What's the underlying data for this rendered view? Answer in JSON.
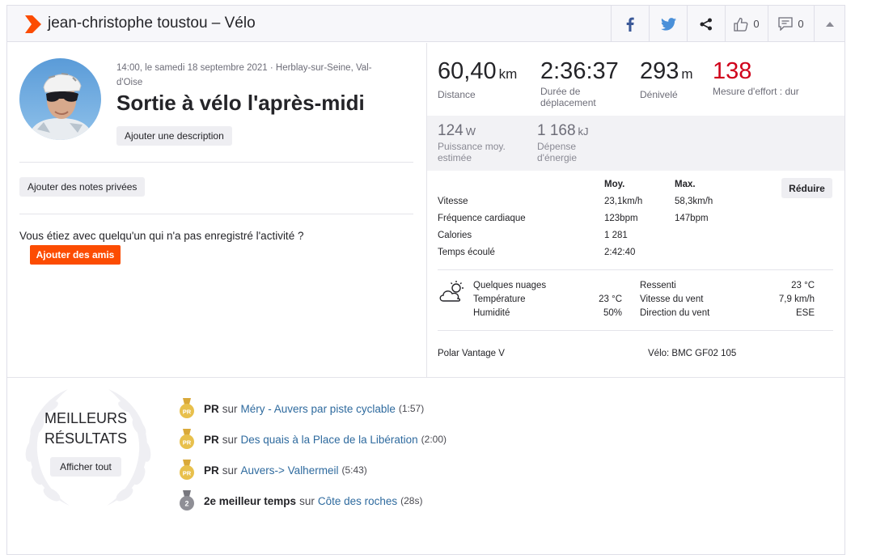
{
  "header": {
    "title": "jean-christophe toustou – Vélo",
    "kudos_count": "0",
    "comments_count": "0"
  },
  "activity": {
    "meta": "14:00, le samedi 18 septembre 2021 · Herblay-sur-Seine, Val-d'Oise",
    "title": "Sortie à vélo l'après-midi",
    "add_description": "Ajouter une description",
    "add_private_notes": "Ajouter des notes privées",
    "with_question": "Vous étiez avec quelqu'un qui n'a pas enregistré l'activité ?",
    "add_friends": "Ajouter des amis"
  },
  "stats": {
    "distance": {
      "value": "60,40",
      "unit": "km",
      "label": "Distance"
    },
    "moving_time": {
      "value": "2:36:37",
      "label": "Durée de déplacement"
    },
    "elevation": {
      "value": "293",
      "unit": "m",
      "label": "Dénivelé"
    },
    "effort": {
      "value": "138",
      "label": "Mesure d'effort : dur"
    },
    "power": {
      "value": "124",
      "unit": "W",
      "label": "Puissance moy. estimée"
    },
    "energy": {
      "value": "1 168",
      "unit": "kJ",
      "label": "Dépense d'énergie"
    }
  },
  "details": {
    "col_avg": "Moy.",
    "col_max": "Max.",
    "collapse": "Réduire",
    "rows": [
      {
        "label": "Vitesse",
        "avg": "23,1km/h",
        "max": "58,3km/h"
      },
      {
        "label": "Fréquence cardiaque",
        "avg": "123bpm",
        "max": "147bpm"
      },
      {
        "label": "Calories",
        "avg": "1 281",
        "max": ""
      },
      {
        "label": "Temps écoulé",
        "avg": "2:42:40",
        "max": ""
      }
    ]
  },
  "weather": {
    "condition": "Quelques nuages",
    "temp_label": "Température",
    "temp_value": "23 °C",
    "humidity_label": "Humidité",
    "humidity_value": "50%",
    "feels_label": "Ressenti",
    "feels_value": "23 °C",
    "wind_speed_label": "Vitesse du vent",
    "wind_speed_value": "7,9 km/h",
    "wind_dir_label": "Direction du vent",
    "wind_dir_value": "ESE"
  },
  "device": "Polar Vantage V",
  "bike": "Vélo: BMC GF02 105",
  "achievements": {
    "title_line1": "MEILLEURS",
    "title_line2": "RÉSULTATS",
    "see_all": "Afficher tout",
    "sur": "sur",
    "items": [
      {
        "rank": "PR",
        "segment": "Méry - Auvers par piste cyclable",
        "time": "(1:57)",
        "medal": "PR"
      },
      {
        "rank": "PR",
        "segment": "Des quais à la Place de la Libération",
        "time": "(2:00)",
        "medal": "PR"
      },
      {
        "rank": "PR",
        "segment": "Auvers-> Valhermeil",
        "time": "(5:43)",
        "medal": "PR"
      },
      {
        "rank": "2e meilleur temps",
        "segment": "Côte des roches",
        "time": "(28s)",
        "medal": "2"
      }
    ]
  },
  "colors": {
    "brand": "#fc4c02",
    "effort": "#d0021b",
    "link": "#2e6a9e",
    "gold": "#e8c04c",
    "silver": "#8f8f96"
  }
}
